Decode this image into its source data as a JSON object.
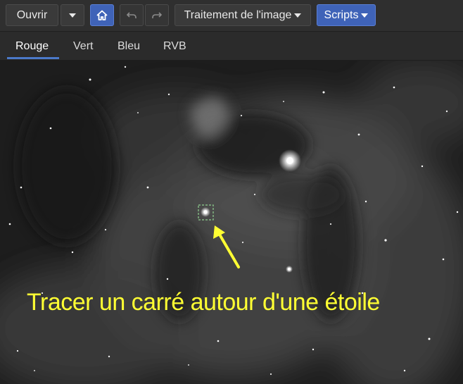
{
  "toolbar": {
    "open_label": "Ouvrir",
    "image_processing_label": "Traitement de l'image",
    "scripts_label": "Scripts",
    "icons": [
      "chevron-down-icon",
      "home-icon",
      "undo-icon",
      "redo-icon"
    ]
  },
  "tabs": [
    {
      "label": "Rouge",
      "active": true
    },
    {
      "label": "Vert",
      "active": false
    },
    {
      "label": "Bleu",
      "active": false
    },
    {
      "label": "RVB",
      "active": false
    }
  ],
  "viewer": {
    "annotation_text": "Tracer un carré autour d'une étoile"
  },
  "colors": {
    "accent_blue": "#3f63b8",
    "tab_underline": "#4b79c9",
    "annotation_yellow": "#ffff33",
    "selection_box": "#8fcf8f"
  }
}
